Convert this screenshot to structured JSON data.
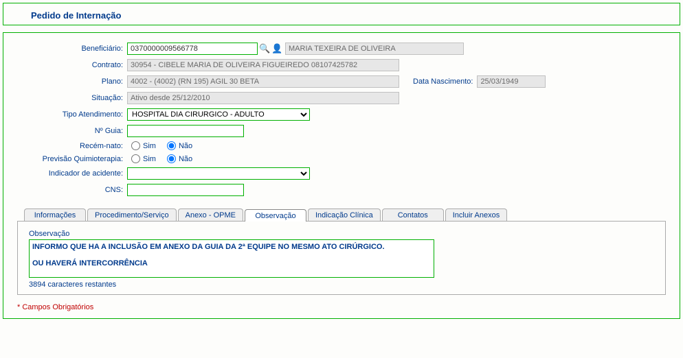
{
  "title": "Pedido de Internação",
  "form": {
    "beneficiario_label": "Beneficiário:",
    "beneficiario_value": "0370000009566778",
    "beneficiario_name": "MARIA TEXEIRA DE OLIVEIRA",
    "contrato_label": "Contrato:",
    "contrato_value": "30954 - CIBELE MARIA DE OLIVEIRA FIGUEIREDO 08107425782",
    "plano_label": "Plano:",
    "plano_value": "4002 - (4002) (RN 195) AGIL 30 BETA",
    "data_nascimento_label": "Data Nascimento:",
    "data_nascimento_value": "25/03/1949",
    "situacao_label": "Situação:",
    "situacao_value": "Ativo desde 25/12/2010",
    "tipo_atendimento_label": "Tipo Atendimento:",
    "tipo_atendimento_value": "HOSPITAL DIA CIRURGICO - ADULTO",
    "nguia_label": "Nº Guia:",
    "nguia_value": "",
    "recem_nato_label": "Recém-nato:",
    "sim_label": "Sim",
    "nao_label": "Não",
    "previsao_quimio_label": "Previsão Quimioterapia:",
    "indicador_acidente_label": "Indicador de acidente:",
    "indicador_acidente_value": "",
    "cns_label": "CNS:",
    "cns_value": ""
  },
  "tabs": {
    "t0": "Informações",
    "t1": "Procedimento/Serviço",
    "t2": "Anexo - OPME",
    "t3": "Observação",
    "t4": "Indicação Clínica",
    "t5": "Contatos",
    "t6": "Incluir Anexos"
  },
  "observacao": {
    "label": "Observação",
    "text": "INFORMO QUE HA A INCLUSÃO EM ANEXO DA GUIA DA 2ª EQUIPE NO MESMO ATO CIRÚRGICO.\n\nOU HAVERÁ INTERCORRÊNCIA",
    "remaining": "3894 caracteres restantes"
  },
  "required_note": "* Campos Obrigatórios"
}
